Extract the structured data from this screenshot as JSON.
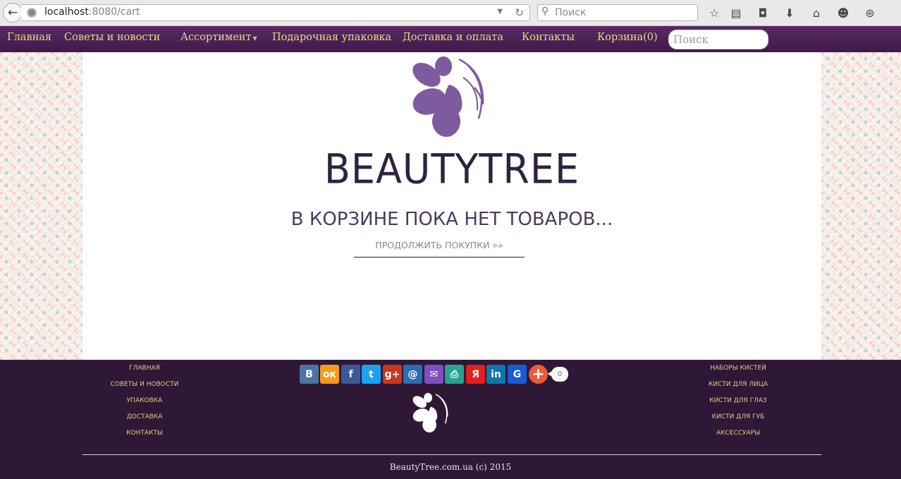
{
  "browser": {
    "url_host": "localhost",
    "url_rest": ":8080/cart",
    "search_placeholder": "Поиск",
    "toolbar_icons": [
      "bookmark-star-icon",
      "reading-list-icon",
      "pocket-icon",
      "downloads-icon",
      "home-icon",
      "chat-icon",
      "sync-icon"
    ]
  },
  "nav": {
    "items": [
      {
        "label": "Главная"
      },
      {
        "label": "Советы и новости"
      },
      {
        "label": "Ассортимент",
        "has_dropdown": true
      },
      {
        "label": "Подарочная упаковка"
      },
      {
        "label": "Доставка и оплата"
      },
      {
        "label": "Контакты"
      },
      {
        "label": "Корзина(0)"
      }
    ],
    "search_placeholder": "Поиск"
  },
  "main": {
    "brand": "BEAUTYTREE",
    "empty_message": "В КОРЗИНЕ ПОКА НЕТ ТОВАРОВ...",
    "continue_link": "ПРОДОЛЖИТЬ ПОКУПКИ »»"
  },
  "footer": {
    "left_links": [
      "ГЛАВНАЯ",
      "СОВЕТЫ И НОВОСТИ",
      "УПАКОВКА",
      "ДОСТАВКА",
      "КОНТАКТЫ"
    ],
    "right_links": [
      "НАБОРЫ КИСТЕЙ",
      "КИСТИ ДЛЯ ЛИЦА",
      "КИСТИ ДЛЯ ГЛАЗ",
      "КИСТИ ДЛЯ ГУБ",
      "АКСЕССУАРЫ"
    ],
    "share_buttons": [
      {
        "name": "vkontakte",
        "glyph": "В",
        "color": "#4c75a3"
      },
      {
        "name": "odnoklassniki",
        "glyph": "ок",
        "color": "#f59a1b"
      },
      {
        "name": "facebook",
        "glyph": "f",
        "color": "#3b5998"
      },
      {
        "name": "twitter",
        "glyph": "t",
        "color": "#1da1f2"
      },
      {
        "name": "google-plus",
        "glyph": "g+",
        "color": "#c6381d"
      },
      {
        "name": "mail-ru",
        "glyph": "@",
        "color": "#2b6bb0"
      },
      {
        "name": "email",
        "glyph": "✉",
        "color": "#7b4fc2"
      },
      {
        "name": "print",
        "glyph": "⎙",
        "color": "#27a38f"
      },
      {
        "name": "yandex",
        "glyph": "Я",
        "color": "#e3201b"
      },
      {
        "name": "linkedin",
        "glyph": "in",
        "color": "#0e76a8"
      },
      {
        "name": "google",
        "glyph": "G",
        "color": "#1a5bd8"
      }
    ],
    "share_count": "0",
    "copyright": "BeautyTree.com.ua (c) 2015"
  },
  "colors": {
    "nav_bg": "#4a2156",
    "nav_text": "#f3d77a",
    "footer_bg": "#2f1836",
    "logo_purple": "#7e5a9e",
    "brand_text": "#2e2241"
  }
}
